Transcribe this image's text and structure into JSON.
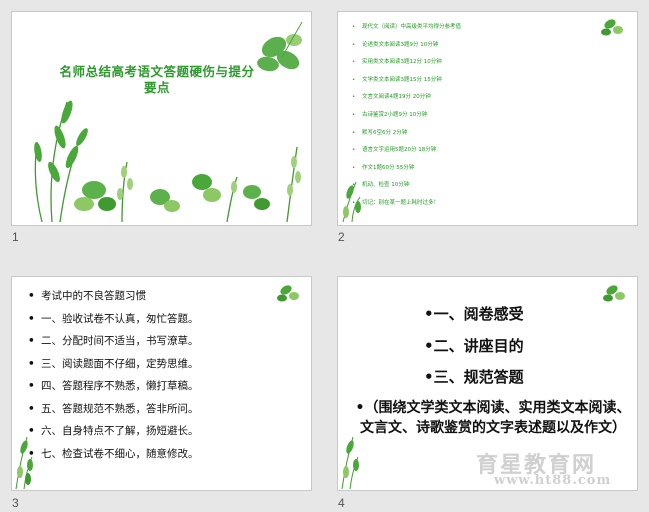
{
  "slides": {
    "s1": {
      "number": "1",
      "title": "名师总结高考语文答题硬伤与提分要点"
    },
    "s2": {
      "number": "2",
      "bullet": "•",
      "items": [
        "现代文（阅读）中高级类平均得分参考值",
        "论述类文本阅读3题9分         10分钟",
        "实用类文本阅读3题12分       10分钟",
        "文学类文本阅读3题15分       15分钟",
        "文言文阅读4题19分                20分钟",
        "古诗鉴赏2小题9分                 10分钟",
        "默写6空6分                               2分钟",
        "语言文字运用5题20分           18分钟",
        "作文1题60分                             55分钟",
        "机动、检查                               10分钟",
        "切记：别在某一题上耗时过多！"
      ]
    },
    "s3": {
      "number": "3",
      "bullet": "•",
      "items": [
        "考试中的不良答题习惯",
        "一、验收试卷不认真，匆忙答题。",
        "二、分配时间不适当，书写潦草。",
        "三、阅读题面不仔细，定势思维。",
        "四、答题程序不熟悉，懒打草稿。",
        "五、答题规范不熟悉，答非所问。",
        "六、自身特点不了解，扬短避长。",
        "七、检查试卷不细心，随意修改。"
      ]
    },
    "s4": {
      "number": "4",
      "items": [
        "•一、阅卷感受",
        "•二、讲座目的",
        "•三、规范答题"
      ],
      "note": "•（围绕文学类文本阅读、实用类文本阅读、文言文、诗歌鉴赏的文字表述题以及作文）"
    }
  },
  "watermark": {
    "line1": "育星教育网",
    "line2": "www.ht88.com"
  },
  "colors": {
    "title_green": "#2d9a2d",
    "text_green": "#1f9c1f",
    "leaf_dark": "#3f9a2f",
    "leaf_light": "#9fd07a"
  }
}
